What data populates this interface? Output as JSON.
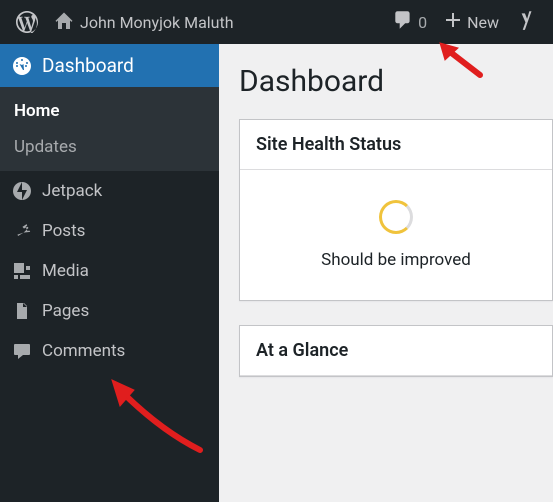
{
  "toolbar": {
    "site_name": "John Monyjok Maluth",
    "comment_count": "0",
    "new_label": "New"
  },
  "sidebar": {
    "dashboard_label": "Dashboard",
    "submenu": {
      "home": "Home",
      "updates": "Updates"
    },
    "jetpack": "Jetpack",
    "posts": "Posts",
    "media": "Media",
    "pages": "Pages",
    "comments": "Comments"
  },
  "content": {
    "page_title": "Dashboard",
    "health_heading": "Site Health Status",
    "health_message": "Should be improved",
    "glance_heading": "At a Glance"
  }
}
